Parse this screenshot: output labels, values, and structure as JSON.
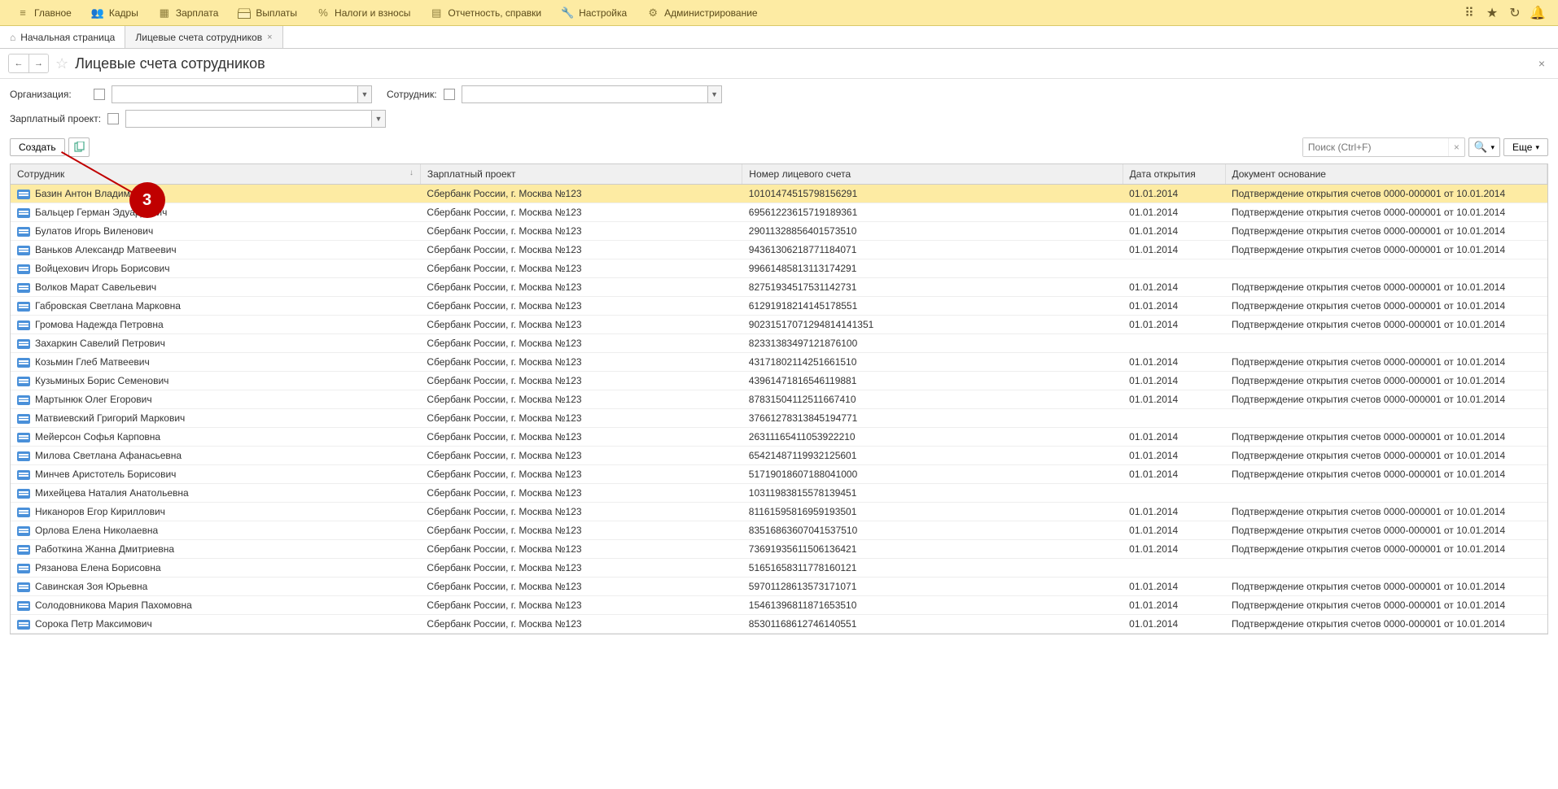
{
  "menu": [
    {
      "label": "Главное",
      "icon": "≡"
    },
    {
      "label": "Кадры",
      "icon": "👥"
    },
    {
      "label": "Зарплата",
      "icon": "▦"
    },
    {
      "label": "Выплаты",
      "icon": "card"
    },
    {
      "label": "Налоги и взносы",
      "icon": "%"
    },
    {
      "label": "Отчетность, справки",
      "icon": "▤"
    },
    {
      "label": "Настройка",
      "icon": "🔧"
    },
    {
      "label": "Администрирование",
      "icon": "⚙"
    }
  ],
  "tabs": [
    {
      "label": "Начальная страница",
      "icon": "⌂",
      "closable": false
    },
    {
      "label": "Лицевые счета сотрудников",
      "closable": true,
      "active": true
    }
  ],
  "page_title": "Лицевые счета сотрудников",
  "filters": {
    "org_label": "Организация:",
    "emp_label": "Сотрудник:",
    "proj_label": "Зарплатный проект:"
  },
  "cmd": {
    "create": "Создать",
    "search_placeholder": "Поиск (Ctrl+F)",
    "more": "Еще"
  },
  "columns": {
    "employee": "Сотрудник",
    "project": "Зарплатный проект",
    "account": "Номер лицевого счета",
    "date": "Дата открытия",
    "doc": "Документ основание"
  },
  "rows": [
    {
      "emp": "Базин Антон Владимирович",
      "proj": "Сбербанк России, г. Москва №123",
      "acc": "10101474515798156291",
      "date": "01.01.2014",
      "doc": "Подтверждение открытия счетов 0000-000001 от 10.01.2014",
      "sel": true
    },
    {
      "emp": "Бальцер Герман Эдуардович",
      "proj": "Сбербанк России, г. Москва №123",
      "acc": "69561223615719189361",
      "date": "01.01.2014",
      "doc": "Подтверждение открытия счетов 0000-000001 от 10.01.2014"
    },
    {
      "emp": "Булатов Игорь Виленович",
      "proj": "Сбербанк России, г. Москва №123",
      "acc": "29011328856401573510",
      "date": "01.01.2014",
      "doc": "Подтверждение открытия счетов 0000-000001 от 10.01.2014"
    },
    {
      "emp": "Ваньков Александр Матвеевич",
      "proj": "Сбербанк России, г. Москва №123",
      "acc": "94361306218771184071",
      "date": "01.01.2014",
      "doc": "Подтверждение открытия счетов 0000-000001 от 10.01.2014"
    },
    {
      "emp": "Войцехович Игорь Борисович",
      "proj": "Сбербанк России, г. Москва №123",
      "acc": "99661485813113174291",
      "date": "",
      "doc": ""
    },
    {
      "emp": "Волков Марат Савельевич",
      "proj": "Сбербанк России, г. Москва №123",
      "acc": "82751934517531142731",
      "date": "01.01.2014",
      "doc": "Подтверждение открытия счетов 0000-000001 от 10.01.2014"
    },
    {
      "emp": "Габровская Светлана Марковна",
      "proj": "Сбербанк России, г. Москва №123",
      "acc": "61291918214145178551",
      "date": "01.01.2014",
      "doc": "Подтверждение открытия счетов 0000-000001 от 10.01.2014"
    },
    {
      "emp": "Громова Надежда Петровна",
      "proj": "Сбербанк России, г. Москва №123",
      "acc": "90231517071294814141351",
      "date": "01.01.2014",
      "doc": "Подтверждение открытия счетов 0000-000001 от 10.01.2014"
    },
    {
      "emp": "Захаркин Савелий Петрович",
      "proj": "Сбербанк России, г. Москва №123",
      "acc": "82331383497121876100",
      "date": "",
      "doc": ""
    },
    {
      "emp": "Козьмин Глеб Матвеевич",
      "proj": "Сбербанк России, г. Москва №123",
      "acc": "43171802114251661510",
      "date": "01.01.2014",
      "doc": "Подтверждение открытия счетов 0000-000001 от 10.01.2014"
    },
    {
      "emp": "Кузьминых Борис Семенович",
      "proj": "Сбербанк России, г. Москва №123",
      "acc": "43961471816546119881",
      "date": "01.01.2014",
      "doc": "Подтверждение открытия счетов 0000-000001 от 10.01.2014"
    },
    {
      "emp": "Мартынюк Олег Егорович",
      "proj": "Сбербанк России, г. Москва №123",
      "acc": "87831504112511667410",
      "date": "01.01.2014",
      "doc": "Подтверждение открытия счетов 0000-000001 от 10.01.2014"
    },
    {
      "emp": "Матвиевский Григорий Маркович",
      "proj": "Сбербанк России, г. Москва №123",
      "acc": "37661278313845194771",
      "date": "",
      "doc": ""
    },
    {
      "emp": "Мейерсон Софья Карповна",
      "proj": "Сбербанк России, г. Москва №123",
      "acc": "26311165411053922210",
      "date": "01.01.2014",
      "doc": "Подтверждение открытия счетов 0000-000001 от 10.01.2014"
    },
    {
      "emp": "Милова Светлана Афанасьевна",
      "proj": "Сбербанк России, г. Москва №123",
      "acc": "65421487119932125601",
      "date": "01.01.2014",
      "doc": "Подтверждение открытия счетов 0000-000001 от 10.01.2014"
    },
    {
      "emp": "Минчев Аристотель Борисович",
      "proj": "Сбербанк России, г. Москва №123",
      "acc": "51719018607188041000",
      "date": "01.01.2014",
      "doc": "Подтверждение открытия счетов 0000-000001 от 10.01.2014"
    },
    {
      "emp": "Михейцева Наталия Анатольевна",
      "proj": "Сбербанк России, г. Москва №123",
      "acc": "10311983815578139451",
      "date": "",
      "doc": ""
    },
    {
      "emp": "Никаноров Егор Кириллович",
      "proj": "Сбербанк России, г. Москва №123",
      "acc": "81161595816959193501",
      "date": "01.01.2014",
      "doc": "Подтверждение открытия счетов 0000-000001 от 10.01.2014"
    },
    {
      "emp": "Орлова Елена Николаевна",
      "proj": "Сбербанк России, г. Москва №123",
      "acc": "83516863607041537510",
      "date": "01.01.2014",
      "doc": "Подтверждение открытия счетов 0000-000001 от 10.01.2014"
    },
    {
      "emp": "Работкина Жанна Дмитриевна",
      "proj": "Сбербанк России, г. Москва №123",
      "acc": "73691935611506136421",
      "date": "01.01.2014",
      "doc": "Подтверждение открытия счетов 0000-000001 от 10.01.2014"
    },
    {
      "emp": "Рязанова Елена Борисовна",
      "proj": "Сбербанк России, г. Москва №123",
      "acc": "51651658311778160121",
      "date": "",
      "doc": ""
    },
    {
      "emp": "Савинская Зоя Юрьевна",
      "proj": "Сбербанк России, г. Москва №123",
      "acc": "59701128613573171071",
      "date": "01.01.2014",
      "doc": "Подтверждение открытия счетов 0000-000001 от 10.01.2014"
    },
    {
      "emp": "Солодовникова Мария Пахомовна",
      "proj": "Сбербанк России, г. Москва №123",
      "acc": "15461396811871653510",
      "date": "01.01.2014",
      "doc": "Подтверждение открытия счетов 0000-000001 от 10.01.2014"
    },
    {
      "emp": "Сорока Петр Максимович",
      "proj": "Сбербанк России, г. Москва №123",
      "acc": "85301168612746140551",
      "date": "01.01.2014",
      "doc": "Подтверждение открытия счетов 0000-000001 от 10.01.2014"
    }
  ],
  "annotation": {
    "number": "3"
  }
}
